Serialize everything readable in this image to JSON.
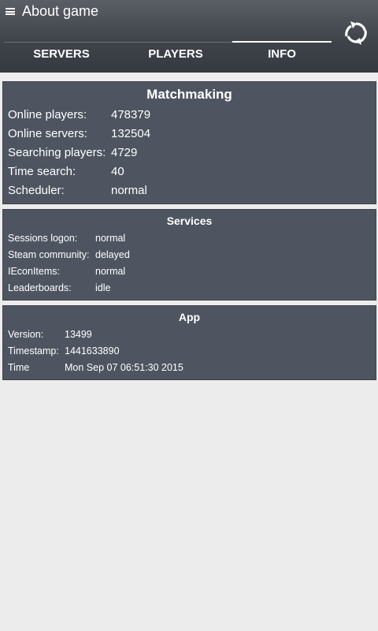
{
  "header": {
    "title": "About game",
    "menu_icon": "menu-icon",
    "refresh_icon": "refresh-icon"
  },
  "tabs": [
    {
      "label": "SERVERS",
      "active": false
    },
    {
      "label": "PLAYERS",
      "active": false
    },
    {
      "label": "INFO",
      "active": true
    }
  ],
  "matchmaking": {
    "title": "Matchmaking",
    "rows": [
      {
        "key": "Online players:",
        "value": "478379"
      },
      {
        "key": "Online servers:",
        "value": "132504"
      },
      {
        "key": "Searching players:",
        "value": "4729"
      },
      {
        "key": "Time search:",
        "value": "40"
      },
      {
        "key": "Scheduler:",
        "value": "normal"
      }
    ]
  },
  "services": {
    "title": "Services",
    "rows": [
      {
        "key": "Sessions logon:",
        "value": "normal"
      },
      {
        "key": "Steam community:",
        "value": "delayed"
      },
      {
        "key": "IEconItems:",
        "value": "normal"
      },
      {
        "key": "Leaderboards:",
        "value": "idle"
      }
    ]
  },
  "app": {
    "title": "App",
    "rows": [
      {
        "key": "Version:",
        "value": "13499"
      },
      {
        "key": "Timestamp:",
        "value": "1441633890"
      },
      {
        "key": "Time",
        "value": "Mon Sep 07 06:51:30 2015"
      }
    ]
  }
}
